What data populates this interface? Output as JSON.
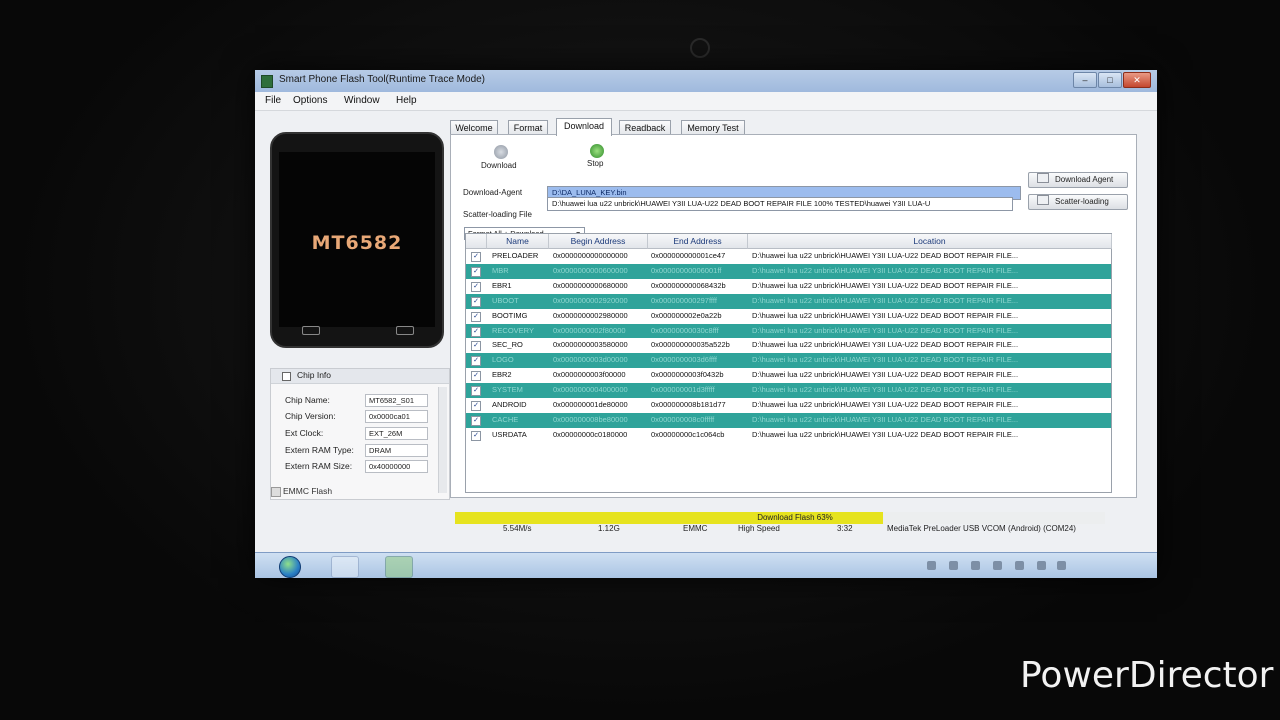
{
  "window": {
    "title": "Smart Phone Flash Tool(Runtime Trace Mode)",
    "controls": {
      "minimize": "–",
      "maximize": "□",
      "close": "✕"
    }
  },
  "menu": [
    "File",
    "Options",
    "Window",
    "Help"
  ],
  "phone": {
    "chip_label": "MT6582"
  },
  "chip_info": {
    "header": "Chip Info",
    "rows": [
      {
        "label": "Chip Name:",
        "value": "MT6582_S01"
      },
      {
        "label": "Chip Version:",
        "value": "0x0000ca01"
      },
      {
        "label": "Ext Clock:",
        "value": "EXT_26M"
      },
      {
        "label": "Extern RAM Type:",
        "value": "DRAM"
      },
      {
        "label": "Extern RAM Size:",
        "value": "0x40000000"
      }
    ],
    "emmc_label": "EMMC Flash"
  },
  "tabs": [
    {
      "label": "Welcome",
      "active": false
    },
    {
      "label": "Format",
      "active": false
    },
    {
      "label": "Download",
      "active": true
    },
    {
      "label": "Readback",
      "active": false
    },
    {
      "label": "Memory Test",
      "active": false
    }
  ],
  "toolbar": {
    "download_label": "Download",
    "stop_label": "Stop"
  },
  "download_agent": {
    "label": "Download-Agent",
    "value": "D:\\DA_LUNA_KEY.bin",
    "button": "Download Agent"
  },
  "scatter": {
    "label": "Scatter-loading File",
    "value": "D:\\huawei lua u22 unbrick\\HUAWEI Y3II LUA-U22 DEAD BOOT REPAIR FILE 100% TESTED\\huawei Y3II LUA-U",
    "button": "Scatter-loading"
  },
  "mode_select": "Format All + Download",
  "table": {
    "columns": [
      "Name",
      "Begin Address",
      "End Address",
      "Location"
    ],
    "rows": [
      {
        "name": "PRELOADER",
        "begin": "0x0000000000000000",
        "end": "0x000000000001ce47",
        "location": "D:\\huawei lua u22 unbrick\\HUAWEI Y3II LUA-U22 DEAD BOOT REPAIR FILE...",
        "highlight": false
      },
      {
        "name": "MBR",
        "begin": "0x0000000000600000",
        "end": "0x00000000006001ff",
        "location": "D:\\huawei lua u22 unbrick\\HUAWEI Y3II LUA-U22 DEAD BOOT REPAIR FILE...",
        "highlight": true
      },
      {
        "name": "EBR1",
        "begin": "0x0000000000680000",
        "end": "0x000000000068432b",
        "location": "D:\\huawei lua u22 unbrick\\HUAWEI Y3II LUA-U22 DEAD BOOT REPAIR FILE...",
        "highlight": false
      },
      {
        "name": "UBOOT",
        "begin": "0x0000000002920000",
        "end": "0x000000000297ffff",
        "location": "D:\\huawei lua u22 unbrick\\HUAWEI Y3II LUA-U22 DEAD BOOT REPAIR FILE...",
        "highlight": true
      },
      {
        "name": "BOOTIMG",
        "begin": "0x0000000002980000",
        "end": "0x000000002e0a22b",
        "location": "D:\\huawei lua u22 unbrick\\HUAWEI Y3II LUA-U22 DEAD BOOT REPAIR FILE...",
        "highlight": false
      },
      {
        "name": "RECOVERY",
        "begin": "0x0000000002f80000",
        "end": "0x00000000030c8fff",
        "location": "D:\\huawei lua u22 unbrick\\HUAWEI Y3II LUA-U22 DEAD BOOT REPAIR FILE...",
        "highlight": true
      },
      {
        "name": "SEC_RO",
        "begin": "0x0000000003580000",
        "end": "0x000000000035a522b",
        "location": "D:\\huawei lua u22 unbrick\\HUAWEI Y3II LUA-U22 DEAD BOOT REPAIR FILE...",
        "highlight": false
      },
      {
        "name": "LOGO",
        "begin": "0x0000000003d00000",
        "end": "0x0000000003d6ffff",
        "location": "D:\\huawei lua u22 unbrick\\HUAWEI Y3II LUA-U22 DEAD BOOT REPAIR FILE...",
        "highlight": true
      },
      {
        "name": "EBR2",
        "begin": "0x0000000003f00000",
        "end": "0x0000000003f0432b",
        "location": "D:\\huawei lua u22 unbrick\\HUAWEI Y3II LUA-U22 DEAD BOOT REPAIR FILE...",
        "highlight": false
      },
      {
        "name": "SYSTEM",
        "begin": "0x0000000004000000",
        "end": "0x000000001d3fffff",
        "location": "D:\\huawei lua u22 unbrick\\HUAWEI Y3II LUA-U22 DEAD BOOT REPAIR FILE...",
        "highlight": true
      },
      {
        "name": "ANDROID",
        "begin": "0x000000001de80000",
        "end": "0x000000008b181d77",
        "location": "D:\\huawei lua u22 unbrick\\HUAWEI Y3II LUA-U22 DEAD BOOT REPAIR FILE...",
        "highlight": false
      },
      {
        "name": "CACHE",
        "begin": "0x000000008be80000",
        "end": "0x000000008c0fffff",
        "location": "D:\\huawei lua u22 unbrick\\HUAWEI Y3II LUA-U22 DEAD BOOT REPAIR FILE...",
        "highlight": true
      },
      {
        "name": "USRDATA",
        "begin": "0x00000000c0180000",
        "end": "0x00000000c1c064cb",
        "location": "D:\\huawei lua u22 unbrick\\HUAWEI Y3II LUA-U22 DEAD BOOT REPAIR FILE...",
        "highlight": false
      }
    ]
  },
  "progress": {
    "label": "Download Flash 63%",
    "fraction": 0.63,
    "color": "#e6e31e"
  },
  "status": {
    "speed": "5.54M/s",
    "size": "1.12G",
    "storage": "EMMC",
    "usb": "High Speed",
    "time": "3:32",
    "port": "MediaTek PreLoader USB VCOM (Android) (COM24)"
  },
  "watermark": "PowerDirector",
  "colors": {
    "row_highlight": "#2fa39a",
    "selection": "#9cbcee",
    "chip_text": "#e8a877"
  }
}
